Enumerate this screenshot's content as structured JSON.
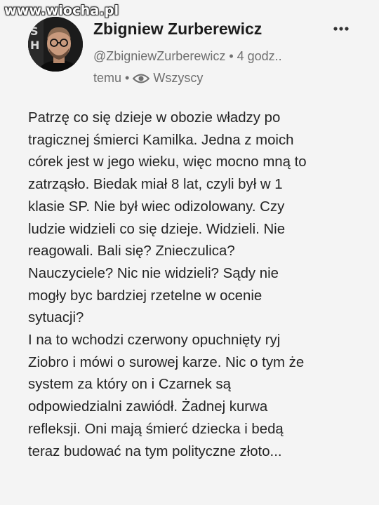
{
  "watermark": "www.wiocha.pl",
  "author": {
    "name": "Zbigniew Zurberewicz",
    "handle_time": "@ZbigniewZurberewicz • 4 godz..",
    "time_suffix": "temu",
    "separator": "•",
    "visibility": "Wszyscy",
    "visibility_icon": "eye-icon",
    "avatar_icon": "avatar"
  },
  "menu_icon": "more-horizontal-icon",
  "post": {
    "lines": [
      "Patrzę co się dzieje w obozie władzy po",
      "tragicznej śmierci Kamilka. Jedna z moich",
      "córek jest w jego wieku, więc mocno mną to",
      "zatrząsło. Biedak miał 8 lat, czyli był w 1",
      "klasie SP. Nie był wiec odizolowany. Czy",
      "ludzie widzieli co się dzieje. Widzieli. Nie",
      "reagowali. Bali się? Znieczulica?",
      "Nauczyciele? Nic nie widzieli? Sądy nie",
      "mogły byc bardziej rzetelne w ocenie",
      "sytuacji?",
      "I na to wchodzi czerwony opuchnięty ryj",
      "Ziobro i mówi o surowej karze. Nic o tym że",
      "system za który on i Czarnek są",
      "odpowiedzialni zawiódł. Żadnej kurwa",
      "refleksji. Oni mają śmierć dziecka i bedą",
      "teraz budować na tym polityczne złoto..."
    ]
  }
}
